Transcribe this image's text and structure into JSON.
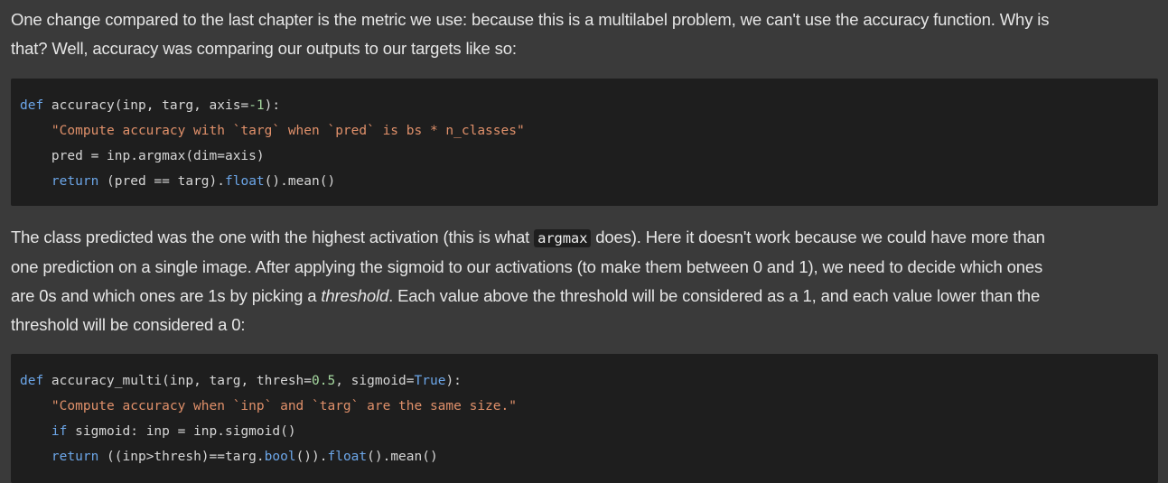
{
  "paragraph1": {
    "line1": "One change compared to the last chapter is the metric we use: because this is a multilabel problem, we can't use the accuracy function. Why is",
    "line2": "that? Well, accuracy was comparing our outputs to our targets like so:"
  },
  "code1": {
    "line1": {
      "kw": "def",
      "rest": " accuracy(inp, targ, axis=",
      "num": "-1",
      "end": "):"
    },
    "line2": {
      "indent": "    ",
      "str": "\"Compute accuracy with `targ` when `pred` is bs * n_classes\""
    },
    "line3": {
      "indent": "    ",
      "text": "pred = inp.argmax(dim=axis)"
    },
    "line4": {
      "indent": "    ",
      "kw": "return",
      "mid": " (pred == targ).",
      "builtin": "float",
      "end": "().mean()"
    }
  },
  "paragraph2": {
    "line1_pre": "The class predicted was the one with the highest activation (this is what ",
    "line1_code": "argmax",
    "line1_post": " does). Here it doesn't work because we could have more than",
    "line2": "one prediction on a single image. After applying the sigmoid to our activations (to make them between 0 and 1), we need to decide which ones",
    "line3_pre": "are 0s and which ones are 1s by picking a ",
    "line3_em": "threshold",
    "line3_post": ". Each value above the threshold will be considered as a 1, and each value lower than the",
    "line4": "threshold will be considered a 0:"
  },
  "code2": {
    "line1": {
      "kw": "def",
      "a": " accuracy_multi(inp, targ, thresh=",
      "num": "0.5",
      "b": ", sigmoid=",
      "kw2": "True",
      "end": "):"
    },
    "line2": {
      "indent": "    ",
      "str": "\"Compute accuracy when `inp` and `targ` are the same size.\""
    },
    "line3": {
      "indent": "    ",
      "kw": "if",
      "rest": " sigmoid: inp = inp.sigmoid()"
    },
    "line4": {
      "indent": "    ",
      "kw": "return",
      "a": " ((inp>thresh)==targ.",
      "builtin1": "bool",
      "b": "()).",
      "builtin2": "float",
      "end": "().mean()"
    }
  },
  "colors": {
    "background": "#3a3a3a",
    "code_background": "#1e1e1e",
    "keyword": "#6ca6e8",
    "string": "#e0906a",
    "number": "#a6d9a0"
  }
}
